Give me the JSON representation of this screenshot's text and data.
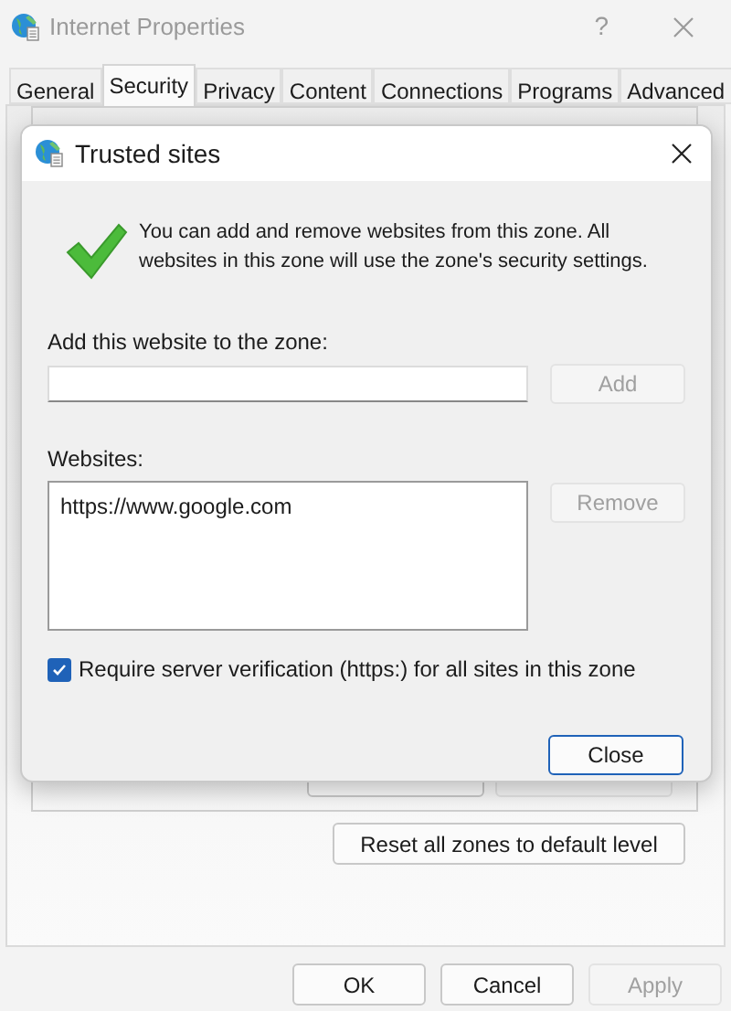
{
  "window": {
    "title": "Internet Properties",
    "help": "?"
  },
  "tabs": [
    {
      "label": "General",
      "selected": false
    },
    {
      "label": "Security",
      "selected": true
    },
    {
      "label": "Privacy",
      "selected": false
    },
    {
      "label": "Content",
      "selected": false
    },
    {
      "label": "Connections",
      "selected": false
    },
    {
      "label": "Programs",
      "selected": false
    },
    {
      "label": "Advanced",
      "selected": false
    }
  ],
  "reset_button": {
    "label": "Reset all zones to default level",
    "disabled": false
  },
  "footer_buttons": [
    {
      "label": "OK",
      "disabled": false
    },
    {
      "label": "Cancel",
      "disabled": false
    },
    {
      "label": "Apply",
      "disabled": true
    }
  ],
  "dialog": {
    "title": "Trusted sites",
    "message": "You can add and remove websites from this zone. All websites in this zone will use the zone's security settings.",
    "add_label": "Add this website to the zone:",
    "add_button": {
      "label": "Add",
      "disabled": true
    },
    "websites_label": "Websites:",
    "websites": [
      "https://www.google.com"
    ],
    "remove_button": {
      "label": "Remove",
      "disabled": true
    },
    "https_checkbox": {
      "label": "Require server verification (https:) for all sites in this zone",
      "checked": true
    },
    "close_button": {
      "label": "Close"
    }
  }
}
